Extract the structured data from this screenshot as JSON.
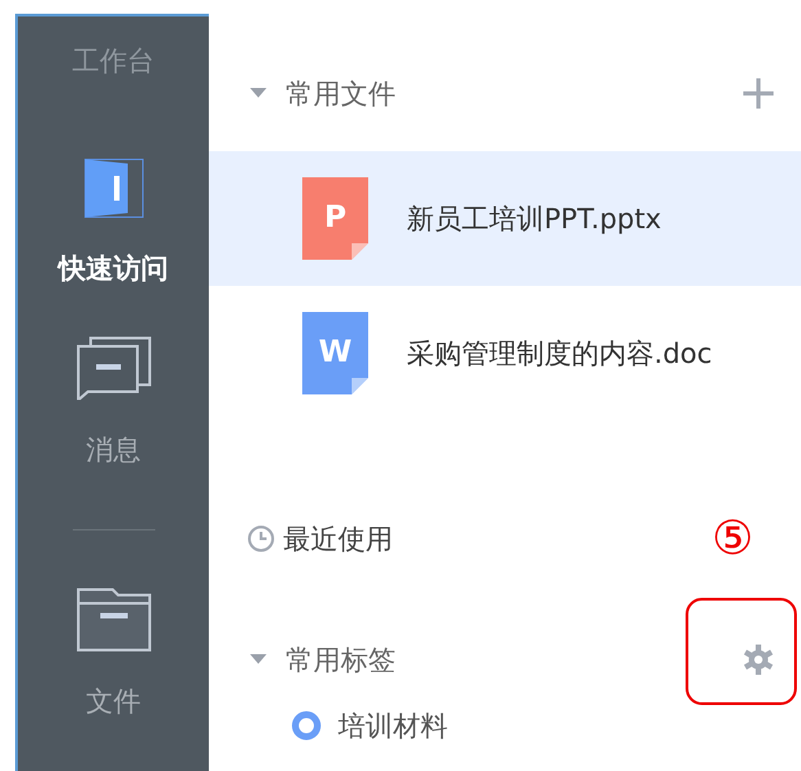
{
  "sidebar": {
    "title": "工作台",
    "items": [
      {
        "kind": "door",
        "label": "快速访问",
        "selected": true
      },
      {
        "kind": "messages",
        "label": "消息",
        "selected": false
      },
      {
        "kind": "divider"
      },
      {
        "kind": "folder",
        "label": "文件",
        "selected": false
      }
    ]
  },
  "sections": [
    {
      "kind": "files",
      "title": "常用文件",
      "expanded": true,
      "items": [
        {
          "kind": "file",
          "type": "P",
          "name": "新员工培训PPT.pptx",
          "color": "#f77e6e",
          "selected": true
        },
        {
          "kind": "file",
          "type": "W",
          "name": "采购管理制度的内容.doc",
          "color": "#6a9ef7",
          "selected": false
        }
      ]
    },
    {
      "kind": "link",
      "title": "最近使用"
    },
    {
      "kind": "tags",
      "title": "常用标签",
      "expanded": true,
      "items": [
        {
          "kind": "tag",
          "name": "培训材料",
          "color": "#6a9ef7"
        }
      ]
    }
  ],
  "annotation": {
    "label": "⑤"
  }
}
